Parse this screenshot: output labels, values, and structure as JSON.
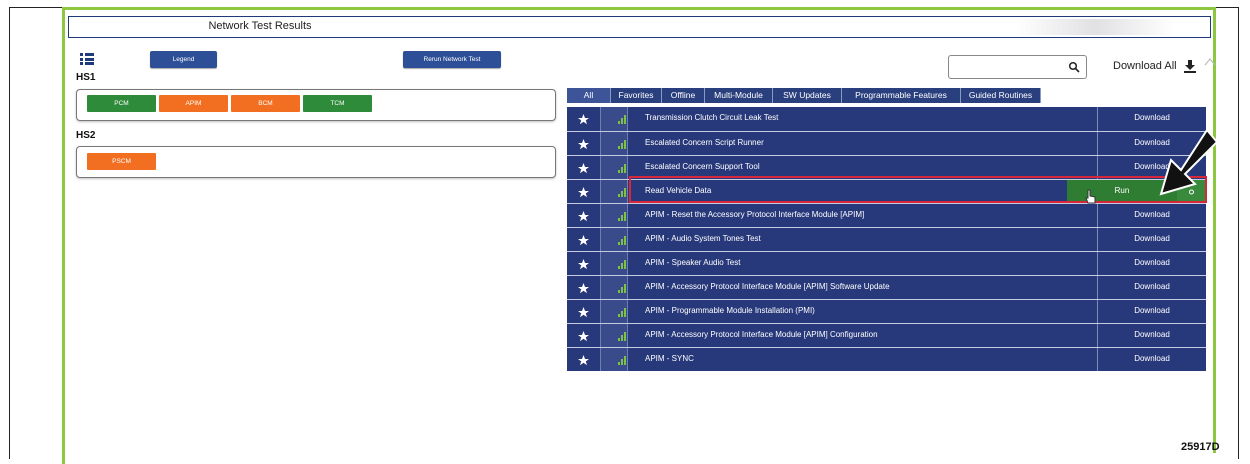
{
  "window": {
    "title": "Network Test Results"
  },
  "toolbar": {
    "legend_label": "Legend",
    "rerun_label": "Rerun Network Test",
    "download_all_label": "Download All"
  },
  "search": {
    "placeholder": ""
  },
  "groups": [
    {
      "label": "HS1",
      "modules": [
        {
          "label": "PCM",
          "color": "#2e8b3a"
        },
        {
          "label": "APIM",
          "color": "#f26f22"
        },
        {
          "label": "BCM",
          "color": "#f26f22"
        },
        {
          "label": "TCM",
          "color": "#2e8b3a"
        }
      ]
    },
    {
      "label": "HS2",
      "modules": [
        {
          "label": "PSCM",
          "color": "#f26f22"
        }
      ]
    }
  ],
  "tabs": [
    "All",
    "Favorites",
    "Offline",
    "Multi-Module",
    "SW Updates",
    "Programmable Features",
    "Guided Routines"
  ],
  "routines": [
    {
      "name": "Transmission Clutch Circuit Leak Test",
      "action": "Download"
    },
    {
      "name": "Escalated Concern Script Runner",
      "action": "Download"
    },
    {
      "name": "Escalated Concern Support Tool",
      "action": "Download"
    },
    {
      "name": "Read Vehicle Data",
      "action": "Run"
    },
    {
      "name": "APIM - Reset the Accessory Protocol Interface Module [APIM]",
      "action": "Download"
    },
    {
      "name": "APIM - Audio System Tones Test",
      "action": "Download"
    },
    {
      "name": "APIM - Speaker Audio Test",
      "action": "Download"
    },
    {
      "name": "APIM - Accessory Protocol Interface Module [APIM] Software Update",
      "action": "Download"
    },
    {
      "name": "APIM - Programmable Module Installation (PMI)",
      "action": "Download"
    },
    {
      "name": "APIM - Accessory Protocol Interface Module [APIM] Configuration",
      "action": "Download"
    },
    {
      "name": "APIM - SYNC",
      "action": "Download"
    }
  ],
  "footer": {
    "code": "25917D"
  },
  "colors": {
    "accent_green": "#8dc63f",
    "table_blue": "#28397b",
    "run_green": "#2e7d32",
    "highlight_red": "#d8273a"
  }
}
